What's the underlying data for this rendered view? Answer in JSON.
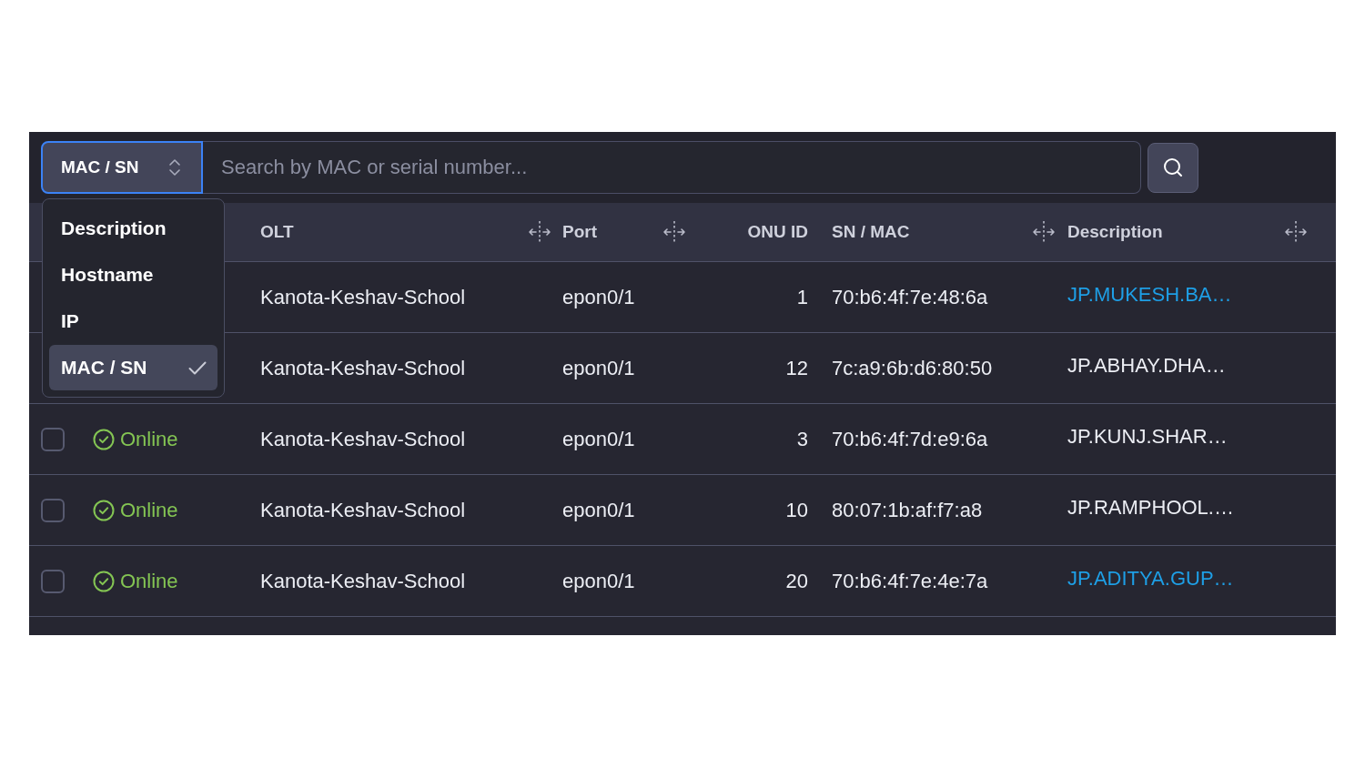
{
  "search": {
    "type_select": {
      "label": "MAC / SN",
      "open": true
    },
    "placeholder": "Search by MAC or serial number..."
  },
  "type_menu": {
    "items": [
      {
        "label": "Description",
        "selected": false
      },
      {
        "label": "Hostname",
        "selected": false
      },
      {
        "label": "IP",
        "selected": false
      },
      {
        "label": "MAC / SN",
        "selected": true
      }
    ]
  },
  "table": {
    "columns": [
      {
        "label": "OLT",
        "resizable": true
      },
      {
        "label": "Port",
        "resizable": true
      },
      {
        "label": "ONU ID",
        "resizable": false
      },
      {
        "label": "SN / MAC",
        "resizable": true
      },
      {
        "label": "Description",
        "resizable": true
      }
    ],
    "rows": [
      {
        "olt": "Kanota-Keshav-School",
        "port": "epon0/1",
        "onu_id": "1",
        "sn_mac": "70:b6:4f:7e:48:6a",
        "description": "JP.MUKESH.BA…",
        "description_link": true
      },
      {
        "olt": "Kanota-Keshav-School",
        "port": "epon0/1",
        "onu_id": "12",
        "sn_mac": "7c:a9:6b:d6:80:50",
        "description": "JP.ABHAY.DHA…",
        "description_link": false
      },
      {
        "checked": false,
        "status": {
          "label": "Online",
          "kind": "online"
        },
        "olt": "Kanota-Keshav-School",
        "port": "epon0/1",
        "onu_id": "3",
        "sn_mac": "70:b6:4f:7d:e9:6a",
        "description": "JP.KUNJ.SHAR…",
        "description_link": false
      },
      {
        "checked": false,
        "status": {
          "label": "Online",
          "kind": "online"
        },
        "olt": "Kanota-Keshav-School",
        "port": "epon0/1",
        "onu_id": "10",
        "sn_mac": "80:07:1b:af:f7:a8",
        "description": "JP.RAMPHOOL.…",
        "description_link": false
      },
      {
        "checked": false,
        "status": {
          "label": "Online",
          "kind": "online"
        },
        "olt": "Kanota-Keshav-School",
        "port": "epon0/1",
        "onu_id": "20",
        "sn_mac": "70:b6:4f:7e:4e:7a",
        "description": "JP.ADITYA.GUP…",
        "description_link": true
      }
    ]
  }
}
